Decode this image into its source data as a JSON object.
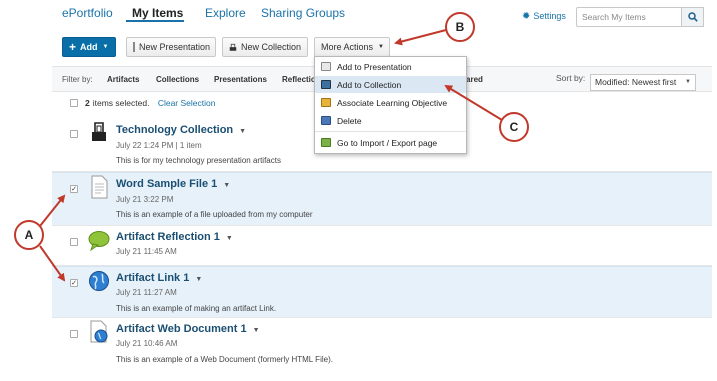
{
  "nav": {
    "eportfolio": "ePortfolio",
    "my_items": "My Items",
    "explore": "Explore",
    "sharing_groups": "Sharing Groups",
    "settings": "Settings",
    "search_placeholder": "Search My Items"
  },
  "toolbar": {
    "add": "Add",
    "new_presentation": "New Presentation",
    "new_collection": "New Collection",
    "more_actions": "More Actions"
  },
  "filter": {
    "label": "Filter by:",
    "options": [
      "Artifacts",
      "Collections",
      "Presentations",
      "Reflectio",
      "ared"
    ],
    "sort_label": "Sort by:",
    "sort_value": "Modified: Newest first"
  },
  "selection": {
    "count": "2",
    "text": "items selected.",
    "clear": "Clear Selection"
  },
  "more_actions_menu": [
    {
      "label": "Add to Presentation",
      "icon": "presentation-icon"
    },
    {
      "label": "Add to Collection",
      "icon": "collection-icon"
    },
    {
      "label": "Associate Learning Objective",
      "icon": "objective-icon"
    },
    {
      "label": "Delete",
      "icon": "trash-icon"
    },
    {
      "label": "Go to Import / Export page",
      "icon": "import-export-icon"
    }
  ],
  "items": [
    {
      "title": "Technology Collection",
      "date": "July 22 1:24 PM | 1 item",
      "desc": "This is for my technology presentation artifacts",
      "icon": "binder-clip-icon",
      "checked": false
    },
    {
      "title": "Word Sample File 1",
      "date": "July 21 3:22 PM",
      "desc": "This is an example of a file uploaded from my computer",
      "icon": "document-icon",
      "checked": true
    },
    {
      "title": "Artifact Reflection 1",
      "date": "July 21 11:45 AM",
      "desc": "",
      "icon": "speech-bubble-icon",
      "checked": false
    },
    {
      "title": "Artifact Link 1",
      "date": "July 21 11:27 AM",
      "desc": "This is an example of making an artifact Link.",
      "icon": "globe-icon",
      "checked": true
    },
    {
      "title": "Artifact Web Document 1",
      "date": "July 21 10:46 AM",
      "desc": "This is an example of a Web Document (formerly HTML File).",
      "icon": "web-document-icon",
      "checked": false
    }
  ],
  "callouts": {
    "a": "A",
    "b": "B",
    "c": "C"
  },
  "colors": {
    "accent": "#0a6fa8",
    "link": "#1a73a8",
    "selected_row": "#e6f1fa",
    "callout_border": "#c0392b",
    "arrow": "#c0392b"
  }
}
